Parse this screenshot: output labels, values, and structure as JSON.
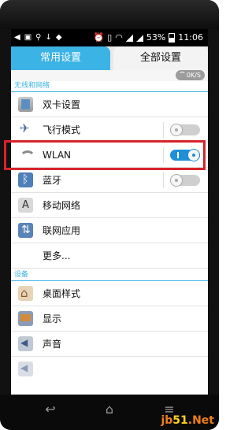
{
  "status_bar": {
    "battery_percent": "53%",
    "time": "11:06"
  },
  "tabs": {
    "common": "常用设置",
    "all": "全部设置"
  },
  "speed_badge": "0K/S",
  "sections": {
    "wireless": "无线和网络",
    "device": "设备"
  },
  "rows": [
    {
      "label": "双卡设置",
      "icon": "dual-sim-icon"
    },
    {
      "label": "飞行模式",
      "icon": "airplane-icon",
      "toggle": "off"
    },
    {
      "label": "WLAN",
      "icon": "wifi-icon",
      "toggle": "on"
    },
    {
      "label": "蓝牙",
      "icon": "bluetooth-icon",
      "toggle": "off"
    },
    {
      "label": "移动网络",
      "icon": "mobile-network-icon"
    },
    {
      "label": "联网应用",
      "icon": "network-apps-icon"
    },
    {
      "label": "更多..."
    },
    {
      "label": "桌面样式",
      "icon": "home-style-icon"
    },
    {
      "label": "显示",
      "icon": "display-icon"
    },
    {
      "label": "声音",
      "icon": "sound-icon"
    }
  ],
  "colors": {
    "accent": "#3bb3e4",
    "highlight": "#d8232a",
    "toggle_on": "#1f8fd8"
  },
  "watermark": {
    "prefix": "jb",
    "num": "51",
    "suffix": ".Net"
  }
}
